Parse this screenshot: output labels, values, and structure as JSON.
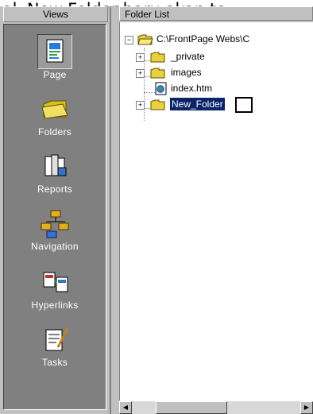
{
  "caption": "al. New Folder baru akan te",
  "views": {
    "header": "Views",
    "items": [
      {
        "label": "Page",
        "icon": "page-view-icon",
        "active": true
      },
      {
        "label": "Folders",
        "icon": "folders-view-icon",
        "active": false
      },
      {
        "label": "Reports",
        "icon": "reports-view-icon",
        "active": false
      },
      {
        "label": "Navigation",
        "icon": "navigation-view-icon",
        "active": false
      },
      {
        "label": "Hyperlinks",
        "icon": "hyperlinks-view-icon",
        "active": false
      },
      {
        "label": "Tasks",
        "icon": "tasks-view-icon",
        "active": false
      }
    ]
  },
  "folder_list": {
    "header": "Folder List",
    "root": "C:\\FrontPage Webs\\C",
    "items": [
      {
        "label": "_private",
        "type": "folder",
        "expander": "+"
      },
      {
        "label": "images",
        "type": "folder",
        "expander": "+"
      },
      {
        "label": "index.htm",
        "type": "file"
      },
      {
        "label": "New_Folder",
        "type": "folder",
        "expander": "+",
        "editing": true
      }
    ]
  },
  "colors": {
    "panel": "#c0c0c0",
    "strip": "#808080",
    "selection": "#0a246a",
    "folder": "#e8d040"
  }
}
